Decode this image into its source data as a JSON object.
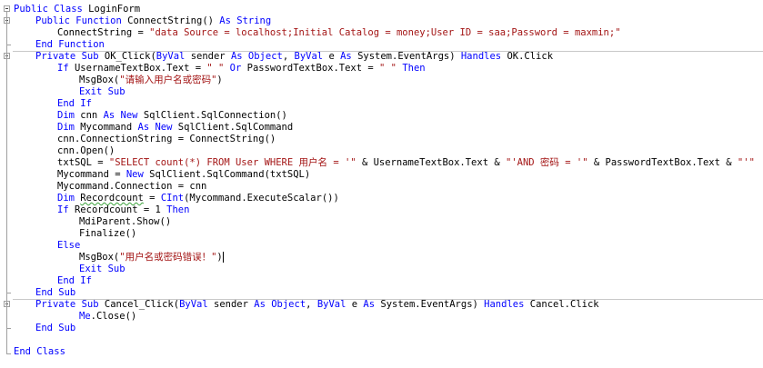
{
  "editor": {
    "lines": [
      {
        "tokens": [
          {
            "t": "Public Class",
            "c": "kw"
          },
          {
            "t": " LoginForm",
            "c": "pl"
          }
        ]
      },
      {
        "tokens": [
          {
            "t": "Public Function",
            "c": "kw"
          },
          {
            "t": " ConnectString() ",
            "c": "pl"
          },
          {
            "t": "As String",
            "c": "kw"
          }
        ]
      },
      {
        "tokens": [
          {
            "t": "ConnectString = ",
            "c": "pl"
          },
          {
            "t": "\"data Source = localhost;Initial Catalog = money;User ID = saa;Password = maxmin;\"",
            "c": "str"
          }
        ]
      },
      {
        "tokens": [
          {
            "t": "End Function",
            "c": "kw"
          }
        ]
      },
      {
        "tokens": [
          {
            "t": "Private Sub",
            "c": "kw"
          },
          {
            "t": " OK_Click(",
            "c": "pl"
          },
          {
            "t": "ByVal",
            "c": "kw"
          },
          {
            "t": " sender ",
            "c": "pl"
          },
          {
            "t": "As Object",
            "c": "kw"
          },
          {
            "t": ", ",
            "c": "pl"
          },
          {
            "t": "ByVal",
            "c": "kw"
          },
          {
            "t": " e ",
            "c": "pl"
          },
          {
            "t": "As",
            "c": "kw"
          },
          {
            "t": " System.EventArgs) ",
            "c": "pl"
          },
          {
            "t": "Handles",
            "c": "kw"
          },
          {
            "t": " OK.Click",
            "c": "pl"
          }
        ]
      },
      {
        "tokens": [
          {
            "t": "If",
            "c": "kw"
          },
          {
            "t": " UsernameTextBox.Text = ",
            "c": "pl"
          },
          {
            "t": "\" \"",
            "c": "str"
          },
          {
            "t": " Or",
            "c": "kw"
          },
          {
            "t": " PasswordTextBox.Text = ",
            "c": "pl"
          },
          {
            "t": "\" \"",
            "c": "str"
          },
          {
            "t": " Then",
            "c": "kw"
          }
        ]
      },
      {
        "tokens": [
          {
            "t": "MsgBox(",
            "c": "pl"
          },
          {
            "t": "\"请输入用户名或密码\"",
            "c": "str"
          },
          {
            "t": ")",
            "c": "pl"
          }
        ]
      },
      {
        "tokens": [
          {
            "t": "Exit Sub",
            "c": "kw"
          }
        ]
      },
      {
        "tokens": [
          {
            "t": "End If",
            "c": "kw"
          }
        ]
      },
      {
        "tokens": [
          {
            "t": "Dim",
            "c": "kw"
          },
          {
            "t": " cnn ",
            "c": "pl"
          },
          {
            "t": "As New",
            "c": "kw"
          },
          {
            "t": " SqlClient.SqlConnection()",
            "c": "pl"
          }
        ]
      },
      {
        "tokens": [
          {
            "t": "Dim",
            "c": "kw"
          },
          {
            "t": " Mycommand ",
            "c": "pl"
          },
          {
            "t": "As New",
            "c": "kw"
          },
          {
            "t": " SqlClient.SqlCommand",
            "c": "pl"
          }
        ]
      },
      {
        "tokens": [
          {
            "t": "cnn.ConnectionString = ConnectString()",
            "c": "pl"
          }
        ]
      },
      {
        "tokens": [
          {
            "t": "cnn.Open()",
            "c": "pl"
          }
        ]
      },
      {
        "tokens": [
          {
            "t": "txtSQL = ",
            "c": "pl"
          },
          {
            "t": "\"SELECT count(*) FROM User WHERE 用户名 = '\"",
            "c": "str"
          },
          {
            "t": " & UsernameTextBox.Text & ",
            "c": "pl"
          },
          {
            "t": "\"'AND 密码 = '\"",
            "c": "str"
          },
          {
            "t": " & PasswordTextBox.Text & ",
            "c": "pl"
          },
          {
            "t": "\"'\"",
            "c": "str"
          }
        ]
      },
      {
        "tokens": [
          {
            "t": "Mycommand = ",
            "c": "pl"
          },
          {
            "t": "New",
            "c": "kw"
          },
          {
            "t": " SqlClient.SqlCommand(txtSQL)",
            "c": "pl"
          }
        ]
      },
      {
        "tokens": [
          {
            "t": "Mycommand.Connection = cnn",
            "c": "pl"
          }
        ]
      },
      {
        "tokens": [
          {
            "t": "Dim",
            "c": "kw"
          },
          {
            "t": " ",
            "c": "pl"
          },
          {
            "t": "Recordcount",
            "c": "sq"
          },
          {
            "t": " = ",
            "c": "pl"
          },
          {
            "t": "CInt",
            "c": "kw"
          },
          {
            "t": "(Mycommand.ExecuteScalar())",
            "c": "pl"
          }
        ]
      },
      {
        "tokens": [
          {
            "t": "If",
            "c": "kw"
          },
          {
            "t": " Recordcount = 1 ",
            "c": "pl"
          },
          {
            "t": "Then",
            "c": "kw"
          }
        ]
      },
      {
        "tokens": [
          {
            "t": "MdiParent.Show()",
            "c": "pl"
          }
        ]
      },
      {
        "tokens": [
          {
            "t": "Finalize()",
            "c": "pl"
          }
        ]
      },
      {
        "tokens": [
          {
            "t": "Else",
            "c": "kw"
          }
        ]
      },
      {
        "tokens": [
          {
            "t": "MsgBox(",
            "c": "pl"
          },
          {
            "t": "\"用户名或密码错误！\"",
            "c": "str"
          },
          {
            "t": ")",
            "c": "pl"
          },
          {
            "t": "",
            "c": "caret"
          }
        ]
      },
      {
        "tokens": [
          {
            "t": "Exit Sub",
            "c": "kw"
          }
        ]
      },
      {
        "tokens": [
          {
            "t": "End If",
            "c": "kw"
          }
        ]
      },
      {
        "tokens": [
          {
            "t": "End Sub",
            "c": "kw"
          }
        ]
      },
      {
        "tokens": [
          {
            "t": "Private Sub",
            "c": "kw"
          },
          {
            "t": " Cancel_Click(",
            "c": "pl"
          },
          {
            "t": "ByVal",
            "c": "kw"
          },
          {
            "t": " sender ",
            "c": "pl"
          },
          {
            "t": "As Object",
            "c": "kw"
          },
          {
            "t": ", ",
            "c": "pl"
          },
          {
            "t": "ByVal",
            "c": "kw"
          },
          {
            "t": " e ",
            "c": "pl"
          },
          {
            "t": "As",
            "c": "kw"
          },
          {
            "t": " System.EventArgs) ",
            "c": "pl"
          },
          {
            "t": "Handles",
            "c": "kw"
          },
          {
            "t": " Cancel.Click",
            "c": "pl"
          }
        ]
      },
      {
        "tokens": [
          {
            "t": "Me",
            "c": "kw"
          },
          {
            "t": ".Close()",
            "c": "pl"
          }
        ]
      },
      {
        "tokens": [
          {
            "t": "End Sub",
            "c": "kw"
          }
        ]
      },
      {
        "tokens": []
      },
      {
        "tokens": [
          {
            "t": "End Class",
            "c": "kw"
          }
        ]
      }
    ]
  },
  "colors": {
    "keyword": "#0000ff",
    "string": "#a31515",
    "plain": "#000000",
    "outline": "#a0a0a0"
  }
}
